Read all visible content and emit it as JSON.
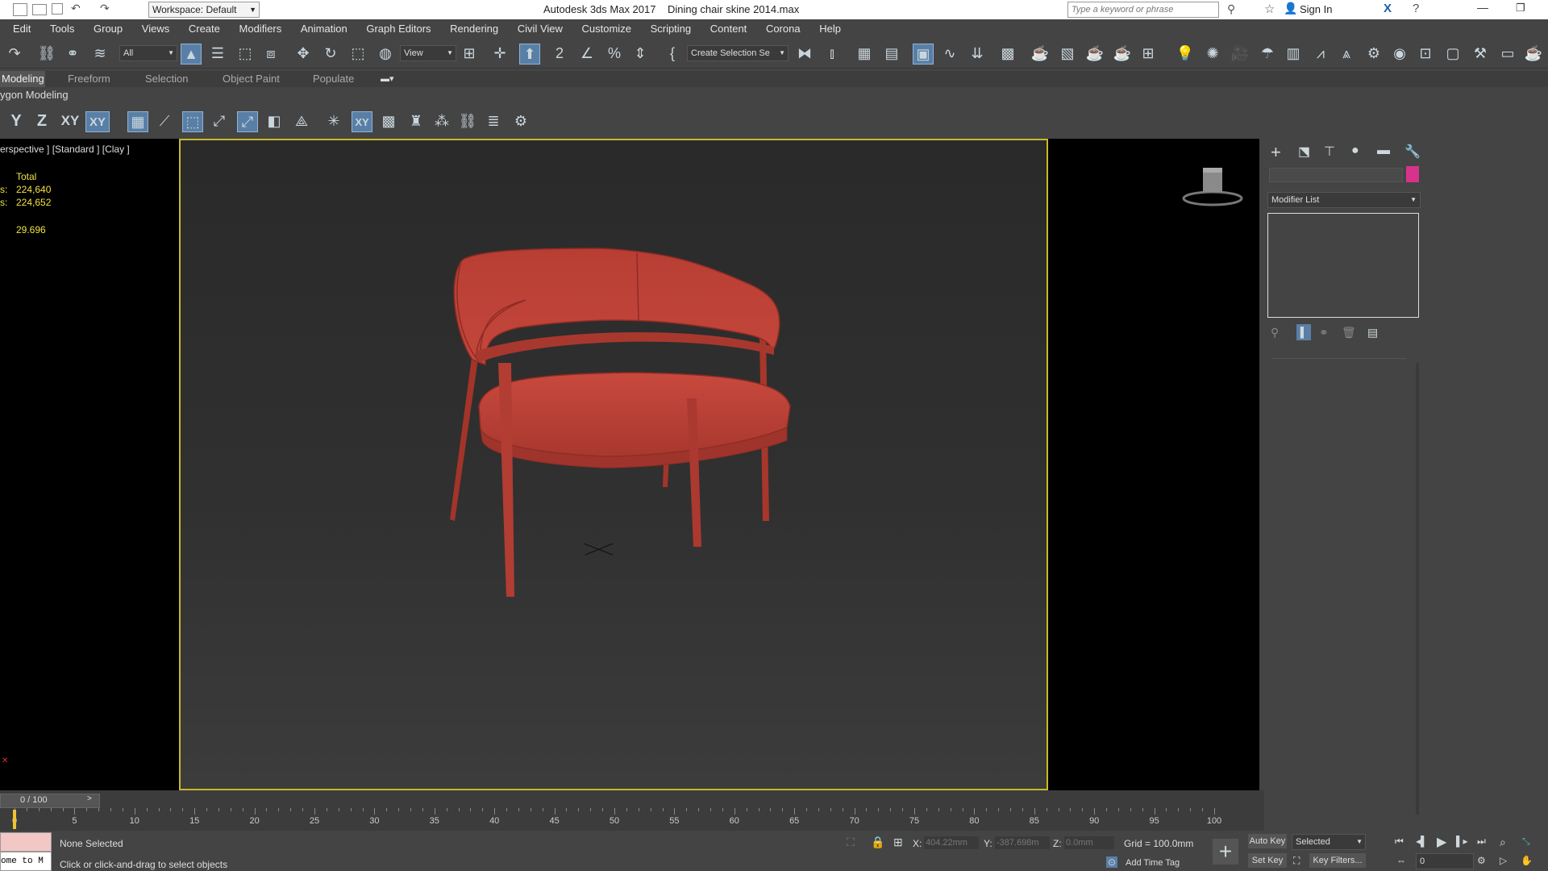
{
  "titlebar": {
    "workspace_label": "Workspace: Default",
    "app_title": "Autodesk 3ds Max 2017",
    "file_title": "Dining chair skine 2014.max",
    "search_placeholder": "Type a keyword or phrase",
    "sign_in": "Sign In"
  },
  "menu": [
    "Edit",
    "Tools",
    "Group",
    "Views",
    "Create",
    "Modifiers",
    "Animation",
    "Graph Editors",
    "Rendering",
    "Civil View",
    "Customize",
    "Scripting",
    "Content",
    "Corona",
    "Help"
  ],
  "toolbar": {
    "filter_value": "All",
    "refcoord_value": "View",
    "named_selection": "Create Selection Se"
  },
  "ribbon": {
    "tabs": [
      "Modeling",
      "Freeform",
      "Selection",
      "Object Paint",
      "Populate"
    ],
    "sub_label": "ygon Modeling"
  },
  "axis_toolbar": [
    "Y",
    "Z",
    "XY",
    "XY"
  ],
  "viewport": {
    "label": "erspective ] [Standard ] [Clay ]",
    "stats": {
      "header": "Total",
      "row1_prefix": "s:",
      "row1": "224,640",
      "row2_prefix": "s:",
      "row2": "224,652",
      "fps": "29.696"
    }
  },
  "cmdpanel": {
    "modifier_list": "Modifier List",
    "object_color": "#d6338c"
  },
  "timeline": {
    "frame_label": "0 / 100",
    "ticks": [
      "0",
      "5",
      "10",
      "15",
      "20",
      "25",
      "30",
      "35",
      "40",
      "45",
      "50",
      "55",
      "60",
      "65",
      "70",
      "75",
      "80",
      "85",
      "90",
      "95",
      "100"
    ]
  },
  "status": {
    "maxscript": "ome to M",
    "selection": "None Selected",
    "prompt": "Click or click-and-drag to select objects",
    "x_label": "X:",
    "x_value": "404.22mm",
    "y_label": "Y:",
    "y_value": "-387.698m",
    "z_label": "Z:",
    "z_value": "0.0mm",
    "grid": "Grid = 100.0mm",
    "add_time_tag": "Add Time Tag",
    "auto_key": "Auto Key",
    "set_key": "Set Key",
    "selected_value": "Selected",
    "key_filters": "Key Filters...",
    "frame_value": "0"
  },
  "colors": {
    "chair": "#c4463b",
    "viewport_border": "#c9b82a",
    "stats": "#f1e342",
    "active_button": "#5a7fa6"
  }
}
